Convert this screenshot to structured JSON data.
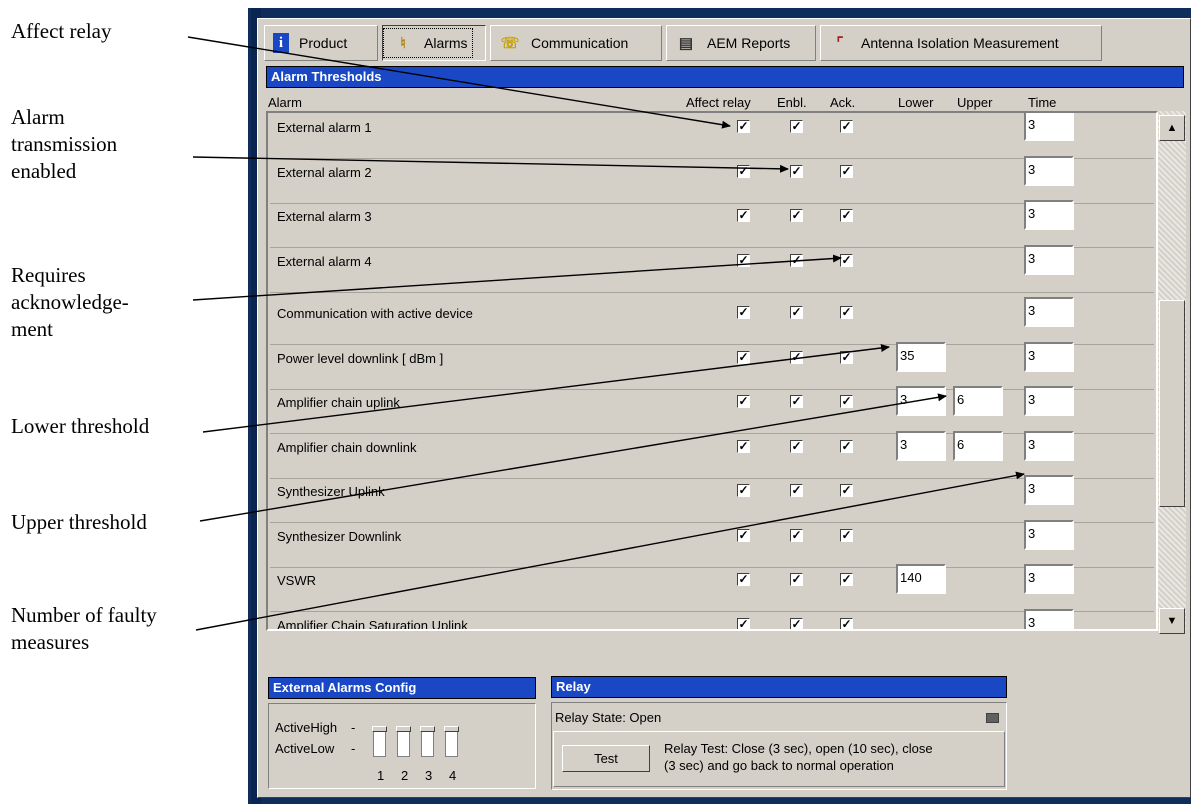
{
  "callouts": {
    "affect_relay": "Affect relay",
    "alarm_transmission": [
      "Alarm",
      "transmission",
      "enabled"
    ],
    "requires_ack": [
      "Requires",
      "acknowledge-",
      "ment"
    ],
    "lower_threshold": "Lower threshold",
    "upper_threshold": "Upper threshold",
    "faulty_measures": [
      "Number of faulty",
      "measures"
    ]
  },
  "tabs": [
    {
      "label": "Product",
      "icon": "info-icon"
    },
    {
      "label": "Alarms",
      "icon": "bell-icon",
      "active": true
    },
    {
      "label": "Communication",
      "icon": "phone-icon"
    },
    {
      "label": "AEM Reports",
      "icon": "document-icon"
    },
    {
      "label": "Antenna Isolation Measurement",
      "icon": "antenna-icon"
    }
  ],
  "alarm_thresholds": {
    "title": "Alarm Thresholds",
    "columns": {
      "alarm": "Alarm",
      "affect_relay": "Affect relay",
      "enbl": "Enbl.",
      "ack": "Ack.",
      "lower": "Lower",
      "upper": "Upper",
      "time": "Time"
    },
    "rows": [
      {
        "name": "External alarm 1",
        "affect": true,
        "enbl": true,
        "ack": true,
        "lower": null,
        "upper": null,
        "time": "3"
      },
      {
        "name": "External alarm 2",
        "affect": true,
        "enbl": true,
        "ack": true,
        "lower": null,
        "upper": null,
        "time": "3"
      },
      {
        "name": "External alarm 3",
        "affect": true,
        "enbl": true,
        "ack": true,
        "lower": null,
        "upper": null,
        "time": "3"
      },
      {
        "name": "External alarm 4",
        "affect": true,
        "enbl": true,
        "ack": true,
        "lower": null,
        "upper": null,
        "time": "3"
      },
      {
        "name": "Communication with active device",
        "affect": true,
        "enbl": true,
        "ack": true,
        "lower": null,
        "upper": null,
        "time": "3"
      },
      {
        "name": "Power level downlink  [ dBm ]",
        "affect": true,
        "enbl": true,
        "ack": true,
        "lower": "35",
        "upper": null,
        "time": "3"
      },
      {
        "name": "Amplifier chain uplink",
        "affect": true,
        "enbl": true,
        "ack": true,
        "lower": "3",
        "upper": "6",
        "time": "3"
      },
      {
        "name": "Amplifier chain downlink",
        "affect": true,
        "enbl": true,
        "ack": true,
        "lower": "3",
        "upper": "6",
        "time": "3"
      },
      {
        "name": "Synthesizer Uplink",
        "affect": true,
        "enbl": true,
        "ack": true,
        "lower": null,
        "upper": null,
        "time": "3"
      },
      {
        "name": "Synthesizer Downlink",
        "affect": true,
        "enbl": true,
        "ack": true,
        "lower": null,
        "upper": null,
        "time": "3"
      },
      {
        "name": "VSWR",
        "affect": true,
        "enbl": true,
        "ack": true,
        "lower": "140",
        "upper": null,
        "time": "3"
      },
      {
        "name": "Amplifier Chain Saturation Uplink",
        "affect": true,
        "enbl": true,
        "ack": true,
        "lower": null,
        "upper": null,
        "time": "3"
      }
    ]
  },
  "external_alarms_config": {
    "title": "External Alarms Config",
    "active_high": "ActiveHigh",
    "active_low": "ActiveLow",
    "switch_numbers": [
      "1",
      "2",
      "3",
      "4"
    ]
  },
  "relay": {
    "title": "Relay",
    "state": "Relay State: Open",
    "test_button": "Test",
    "test_description_line1": "Relay Test: Close (3 sec), open (10 sec), close",
    "test_description_line2": "(3 sec) and go back to normal operation"
  },
  "colors": {
    "title_bar": "#1a48c4",
    "window_frame": "#0f2d5a",
    "panel": "#d4d0c8"
  }
}
